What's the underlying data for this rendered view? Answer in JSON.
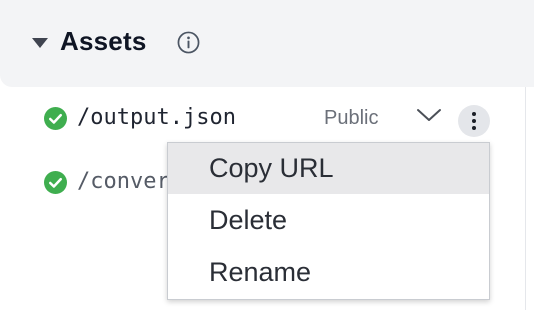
{
  "section": {
    "title": "Assets",
    "expanded": true,
    "icons": {
      "collapse": "caret-down-icon",
      "info": "info-circle-icon"
    }
  },
  "assets": [
    {
      "path": "/output.json",
      "status": "success",
      "visibility": "Public"
    },
    {
      "path": "/conver",
      "status": "success"
    }
  ],
  "context_menu": {
    "items": [
      {
        "label": "Copy URL",
        "highlighted": true
      },
      {
        "label": "Delete"
      },
      {
        "label": "Rename"
      }
    ]
  },
  "colors": {
    "header_bg": "#f3f4f6",
    "success_green": "#3fae4f",
    "menu_highlight": "#e8e8ea"
  }
}
